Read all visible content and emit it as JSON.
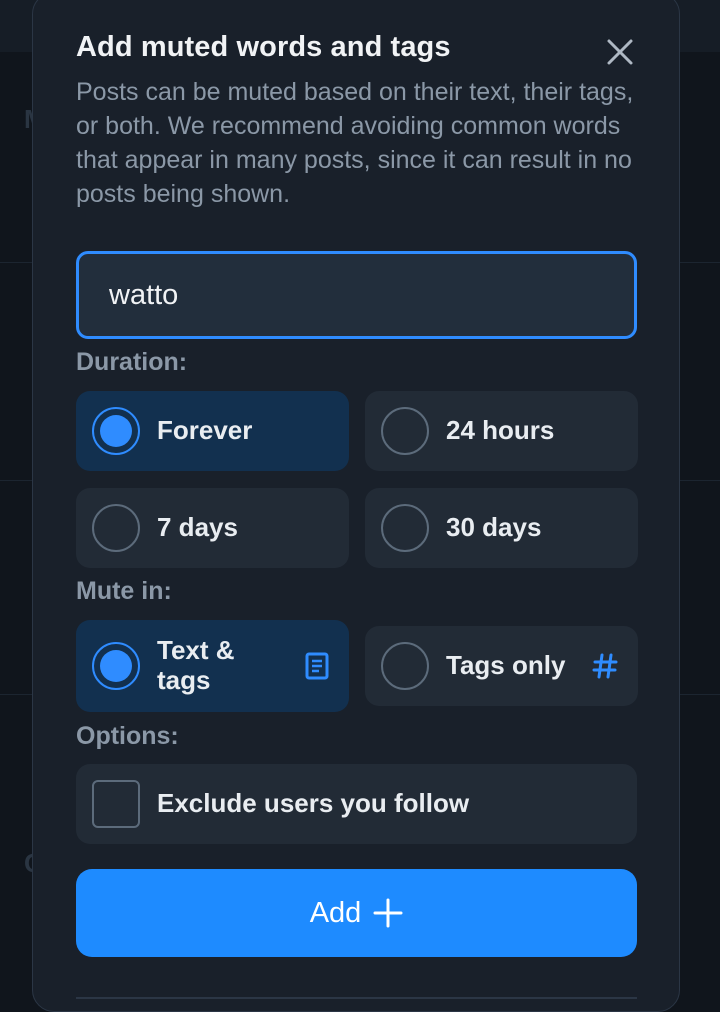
{
  "dialog": {
    "title": "Add muted words and tags",
    "description": "Posts can be muted based on their text, their tags, or both. We recommend avoiding common words that appear in many posts, since it can result in no posts being shown.",
    "input_value": "watto",
    "close_icon": "close-icon"
  },
  "duration": {
    "label": "Duration:",
    "options": [
      {
        "label": "Forever",
        "selected": true
      },
      {
        "label": "24 hours",
        "selected": false
      },
      {
        "label": "7 days",
        "selected": false
      },
      {
        "label": "30 days",
        "selected": false
      }
    ]
  },
  "mute_in": {
    "label": "Mute in:",
    "options": [
      {
        "label": "Text & tags",
        "selected": true,
        "icon": "document-icon"
      },
      {
        "label": "Tags only",
        "selected": false,
        "icon": "hashtag-icon"
      }
    ]
  },
  "options": {
    "label": "Options:",
    "exclude_following": {
      "label": "Exclude users you follow",
      "checked": false
    }
  },
  "add_button": {
    "label": "Add",
    "icon": "plus-icon"
  },
  "colors": {
    "accent": "#1e8bff",
    "dialog_bg": "#19202a",
    "option_bg": "#222b36",
    "option_selected_bg": "#12304f",
    "muted_text": "#8b98a7"
  },
  "background": {
    "letters": [
      "M",
      "C"
    ]
  }
}
